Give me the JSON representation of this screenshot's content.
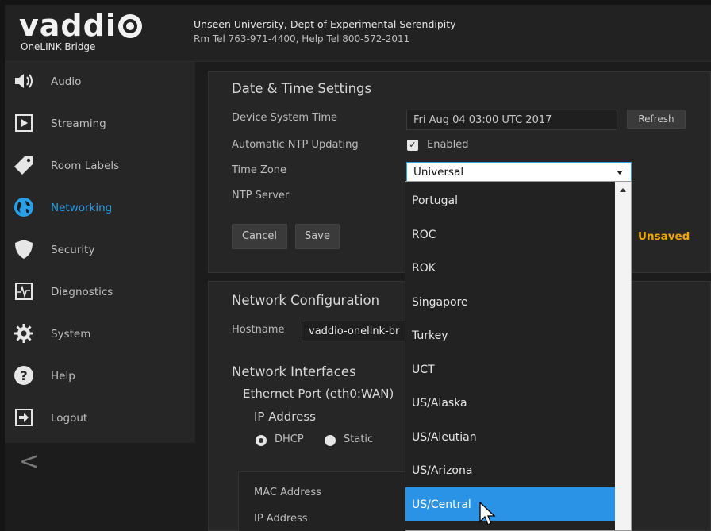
{
  "header": {
    "logo": "vaddi",
    "product": "OneLINK Bridge",
    "org_line1": "Unseen University, Dept of Experimental Serendipity",
    "org_line2": "Rm Tel 763-971-4400, Help Tel 800-572-2011"
  },
  "sidebar": {
    "items": [
      {
        "label": "Audio",
        "icon": "speaker-icon"
      },
      {
        "label": "Streaming",
        "icon": "play-icon"
      },
      {
        "label": "Room Labels",
        "icon": "tag-icon"
      },
      {
        "label": "Networking",
        "icon": "globe-icon",
        "active": true
      },
      {
        "label": "Security",
        "icon": "shield-icon"
      },
      {
        "label": "Diagnostics",
        "icon": "pulse-icon"
      },
      {
        "label": "System",
        "icon": "gear-icon"
      },
      {
        "label": "Help",
        "icon": "help-icon"
      },
      {
        "label": "Logout",
        "icon": "logout-icon"
      }
    ],
    "collapse": "<"
  },
  "datetime": {
    "title": "Date & Time Settings",
    "device_time_label": "Device System Time",
    "device_time_value": "Fri Aug 04 03:00 UTC 2017",
    "refresh": "Refresh",
    "ntp_label": "Automatic NTP Updating",
    "ntp_value": "Enabled",
    "timezone_label": "Time Zone",
    "timezone_value": "Universal",
    "ntp_server_label": "NTP Server",
    "cancel": "Cancel",
    "save": "Save",
    "unsaved": "Unsaved"
  },
  "dropdown": {
    "options": [
      "Portugal",
      "ROC",
      "ROK",
      "Singapore",
      "Turkey",
      "UCT",
      "US/Alaska",
      "US/Aleutian",
      "US/Arizona",
      "US/Central"
    ],
    "highlighted": "US/Central"
  },
  "network": {
    "title": "Network Configuration",
    "hostname_label": "Hostname",
    "hostname_value": "vaddio-onelink-br",
    "interfaces_title": "Network Interfaces",
    "port_label": "Ethernet Port (eth0:WAN)",
    "ip_address_title": "IP Address",
    "dhcp": "DHCP",
    "static": "Static",
    "mac_label": "MAC Address",
    "ip_label": "IP Address"
  },
  "colors": {
    "accent": "#2a9fe8",
    "highlight": "#2b93e6",
    "unsaved": "#f0a800",
    "background": "#1c1c1c"
  }
}
